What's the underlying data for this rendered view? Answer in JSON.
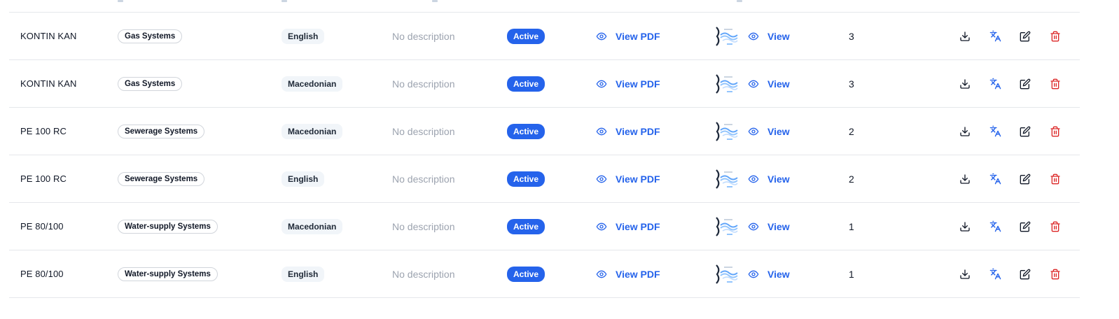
{
  "table": {
    "rows": [
      {
        "name": "KONTIN KAN",
        "category": "Gas Systems",
        "language": "English",
        "description": "No description",
        "status": "Active",
        "pdf_label": "View PDF",
        "image_label": "View",
        "count": "3"
      },
      {
        "name": "KONTIN KAN",
        "category": "Gas Systems",
        "language": "Macedonian",
        "description": "No description",
        "status": "Active",
        "pdf_label": "View PDF",
        "image_label": "View",
        "count": "3"
      },
      {
        "name": "PE 100 RC",
        "category": "Sewerage Systems",
        "language": "Macedonian",
        "description": "No description",
        "status": "Active",
        "pdf_label": "View PDF",
        "image_label": "View",
        "count": "2"
      },
      {
        "name": "PE 100 RC",
        "category": "Sewerage Systems",
        "language": "English",
        "description": "No description",
        "status": "Active",
        "pdf_label": "View PDF",
        "image_label": "View",
        "count": "2"
      },
      {
        "name": "PE 80/100",
        "category": "Water-supply Systems",
        "language": "Macedonian",
        "description": "No description",
        "status": "Active",
        "pdf_label": "View PDF",
        "image_label": "View",
        "count": "1"
      },
      {
        "name": "PE 80/100",
        "category": "Water-supply Systems",
        "language": "English",
        "description": "No description",
        "status": "Active",
        "pdf_label": "View PDF",
        "image_label": "View",
        "count": "1"
      }
    ],
    "actions": [
      "download-icon",
      "translate-icon",
      "edit-icon",
      "trash-icon"
    ]
  },
  "colors": {
    "accent": "#2563eb",
    "danger": "#dc2626",
    "muted": "#9ca3af",
    "border": "#e5e7eb"
  }
}
